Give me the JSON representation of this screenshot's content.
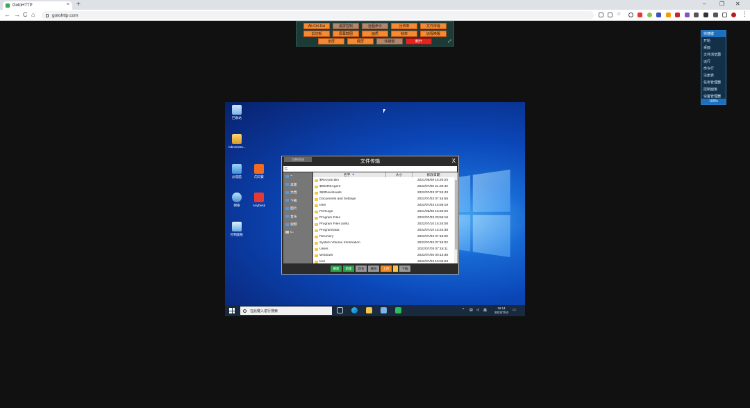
{
  "browser": {
    "tab_title": "GotoHTTP",
    "tab_close": "×",
    "new_tab": "+",
    "url": "gotohttp.com",
    "nav": {
      "back": "←",
      "forward": "→",
      "reload": "C",
      "home": "⌂"
    },
    "window_controls": {
      "minimize": "–",
      "restore": "❐",
      "close": "✕"
    },
    "menu": "⋮"
  },
  "toolbar": {
    "row1": [
      "Alt-Ctrl-Del",
      "黑屏控制",
      "远程命令",
      "分辨率",
      "文件传输"
    ],
    "row2": [
      "剪切板",
      "屏幕截图",
      "画质",
      "帧率",
      "远程唤醒"
    ],
    "row3": [
      "全屏",
      "截屏",
      "快捷键",
      "断开"
    ],
    "resize": "⤢"
  },
  "quick_panel": {
    "title": "快捷键",
    "items": [
      "开始",
      "桌面",
      "文件浏览器",
      "运行",
      "命令行",
      "注册表",
      "任务管理器",
      "控制面板",
      "设备管理器"
    ],
    "zoom": "100%"
  },
  "desktop": {
    "icons": [
      {
        "label": "回收站"
      },
      {
        "label": "Administra..."
      },
      {
        "label": "此电脑"
      },
      {
        "label": "向日葵"
      },
      {
        "label": "网络"
      },
      {
        "label": "AnyDesk"
      },
      {
        "label": "控制面板"
      }
    ]
  },
  "taskbar": {
    "search_placeholder": "在此键入进行搜索",
    "time": "16:14",
    "date": "2022/7/10"
  },
  "file_transfer": {
    "title": "文件传输",
    "switch_label": "切换目录",
    "close": "X",
    "path": "C:",
    "sidebar": [
      "~",
      "桌面",
      "文档",
      "下载",
      "图片",
      "音乐",
      "视频",
      "C:"
    ],
    "columns": {
      "name": "名字",
      "size": "大小",
      "date": "修改日期"
    },
    "sort_arrow": "▲",
    "files": [
      {
        "name": "$Recycle.Bin",
        "date": "2021/05/08 16:20:20"
      },
      {
        "name": "$WinREAgent",
        "date": "2022/07/05 21:29:42"
      },
      {
        "name": "360Downloads",
        "date": "2022/07/03 07:24:43"
      },
      {
        "name": "Documents and Settings",
        "date": "2022/07/03 07:15:56"
      },
      {
        "name": "Intel",
        "date": "2022/07/03 15:59:19"
      },
      {
        "name": "PerfLogs",
        "date": "2021/05/08 16:20:20"
      },
      {
        "name": "Program Files",
        "date": "2022/07/03 20:56:19"
      },
      {
        "name": "Program Files (x86)",
        "date": "2022/07/10 15:24:08"
      },
      {
        "name": "ProgramData",
        "date": "2022/07/10 15:24:38"
      },
      {
        "name": "Recovery",
        "date": "2022/07/03 07:16:00"
      },
      {
        "name": "System Volume Information",
        "date": "2022/07/03 07:15:02"
      },
      {
        "name": "Users",
        "date": "2022/07/03 07:18:11"
      },
      {
        "name": "Windows",
        "date": "2022/07/06 00:13:38"
      },
      {
        "name": "tool",
        "date": "2022/07/03 16:04:23"
      }
    ],
    "buttons": [
      "刷新",
      "新建",
      "改名",
      "删除",
      "上传",
      "下载"
    ]
  }
}
